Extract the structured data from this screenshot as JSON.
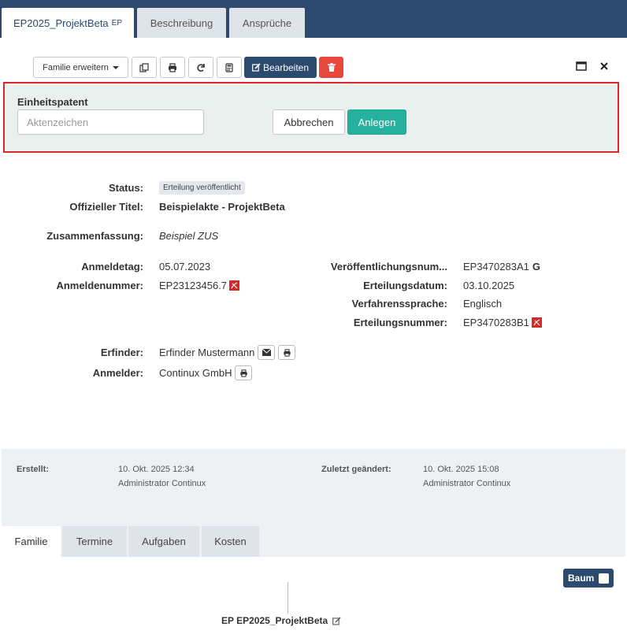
{
  "top_tabs": [
    {
      "label": "EP2025_ProjektBeta",
      "suffix": "EP"
    },
    {
      "label": "Beschreibung"
    },
    {
      "label": "Ansprüche"
    }
  ],
  "toolbar": {
    "family_extend": "Familie erweitern",
    "edit": "Bearbeiten"
  },
  "highlight": {
    "label": "Einheitspatent",
    "input_placeholder": "Aktenzeichen",
    "cancel": "Abbrechen",
    "create": "Anlegen"
  },
  "fields": {
    "status_label": "Status:",
    "status_value": "Erteilung veröffentlicht",
    "title_label": "Offizieller Titel:",
    "title_value": "Beispielakte - ProjektBeta",
    "summary_label": "Zusammenfassung:",
    "summary_value": "Beispiel ZUS",
    "filing_date_label": "Anmeldetag:",
    "filing_date_value": "05.07.2023",
    "app_number_label": "Anmeldenummer:",
    "app_number_value": "EP23123456.7",
    "pub_number_label": "Veröffentlichungsnum...",
    "pub_number_value": "EP3470283A1",
    "grant_date_label": "Erteilungsdatum:",
    "grant_date_value": "03.10.2025",
    "language_label": "Verfahrenssprache:",
    "language_value": "Englisch",
    "grant_number_label": "Erteilungsnummer:",
    "grant_number_value": "EP3470283B1",
    "inventor_label": "Erfinder:",
    "inventor_value": "Erfinder Mustermann",
    "applicant_label": "Anmelder:",
    "applicant_value": "Continux GmbH"
  },
  "meta": {
    "created_label": "Erstellt:",
    "created_date": "10. Okt. 2025 12:34",
    "created_by": "Administrator Continux",
    "changed_label": "Zuletzt geändert:",
    "changed_date": "10. Okt. 2025 15:08",
    "changed_by": "Administrator Continux"
  },
  "bottom_tabs": [
    "Familie",
    "Termine",
    "Aufgaben",
    "Kosten"
  ],
  "tree": {
    "toggle_label": "Baum",
    "node_label": "EP EP2025_ProjektBeta"
  },
  "colors": {
    "header": "#2c4a6e",
    "edit_button": "#2c4a6e",
    "delete_button": "#e8473e",
    "create_button": "#26b19e",
    "highlight_border": "#d9262b"
  }
}
